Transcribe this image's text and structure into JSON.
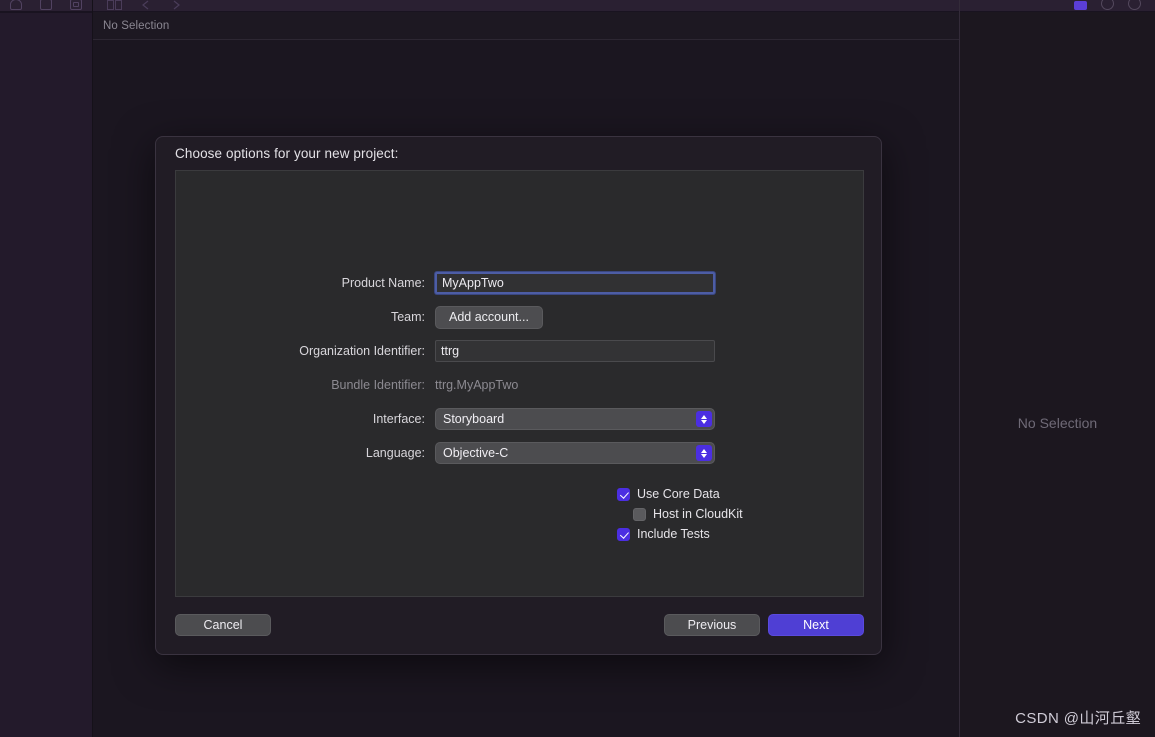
{
  "window": {
    "jump_bar_label": "No Selection",
    "navigator_icons": [
      "history-icon",
      "folder-icon",
      "report-icon"
    ],
    "editor_icons": [
      "editor-layout-icon",
      "back-chevron-icon",
      "forward-chevron-icon"
    ],
    "inspector_icons": [
      "inspector-chip-icon",
      "help-circle-icon",
      "add-circle-icon"
    ]
  },
  "inspector": {
    "empty_label": "No Selection",
    "watermark": "CSDN @山河丘壑"
  },
  "sheet": {
    "title": "Choose options for your new project:",
    "fields": [
      {
        "label": "Product Name:",
        "type": "text",
        "value": "MyAppTwo",
        "placeholder": "",
        "focused": true
      },
      {
        "label": "Team:",
        "type": "button",
        "value": "Add account..."
      },
      {
        "label": "Organization Identifier:",
        "type": "text",
        "value": "ttrg",
        "placeholder": "",
        "focused": false
      },
      {
        "label": "Bundle Identifier:",
        "type": "static",
        "value": "ttrg.MyAppTwo"
      },
      {
        "label": "Interface:",
        "type": "popup",
        "value": "Storyboard"
      },
      {
        "label": "Language:",
        "type": "popup",
        "value": "Objective-C"
      }
    ],
    "checkboxes": [
      {
        "label": "Use Core Data",
        "checked": true,
        "indent": false
      },
      {
        "label": "Host in CloudKit",
        "checked": false,
        "indent": true
      },
      {
        "label": "Include Tests",
        "checked": true,
        "indent": false
      }
    ],
    "buttons": {
      "cancel": "Cancel",
      "previous": "Previous",
      "next": "Next"
    }
  },
  "colors": {
    "accent_purple": "#4b2ee2",
    "next_button": "#4f3fd4",
    "focus_ring": "#4d5da5",
    "sidebar_purple": "#231a2b",
    "panel_gray": "#2a2a2c"
  }
}
